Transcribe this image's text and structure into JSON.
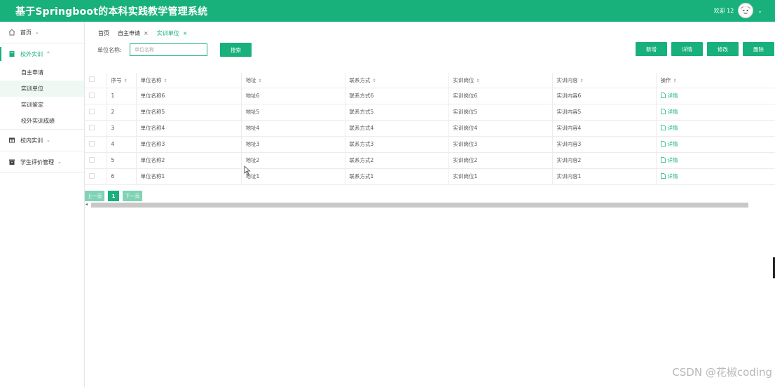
{
  "app": {
    "title": "基于Springboot的本科实践教学管理系统",
    "welcome": "欢迎 12"
  },
  "colors": {
    "accent": "#18b07b",
    "accent_light": "#7fd3b4"
  },
  "sidebar": {
    "home": "首页",
    "group_outside": "校外实训",
    "sub_items": [
      "自主申请",
      "实训单位",
      "实训鉴定",
      "校外实训成绩"
    ],
    "group_inside": "校内实训",
    "group_eval": "学生评价管理"
  },
  "tabs": [
    "首页",
    "自主申请",
    "实训单位"
  ],
  "search": {
    "label": "单位名称:",
    "placeholder": "单位名称",
    "button": "搜索"
  },
  "actions": {
    "add": "新增",
    "detail": "详情",
    "edit": "修改",
    "delete": "删除"
  },
  "table": {
    "headers": [
      "序号",
      "单位名称",
      "地址",
      "联系方式",
      "实训岗位",
      "实训内容",
      "操作"
    ],
    "rows": [
      [
        "1",
        "单位名称6",
        "地址6",
        "联系方式6",
        "实训岗位6",
        "实训内容6",
        "详情"
      ],
      [
        "2",
        "单位名称5",
        "地址5",
        "联系方式5",
        "实训岗位5",
        "实训内容5",
        "详情"
      ],
      [
        "3",
        "单位名称4",
        "地址4",
        "联系方式4",
        "实训岗位4",
        "实训内容4",
        "详情"
      ],
      [
        "4",
        "单位名称3",
        "地址3",
        "联系方式3",
        "实训岗位3",
        "实训内容3",
        "详情"
      ],
      [
        "5",
        "单位名称2",
        "地址2",
        "联系方式2",
        "实训岗位2",
        "实训内容2",
        "详情"
      ],
      [
        "6",
        "单位名称1",
        "地址1",
        "联系方式1",
        "实训岗位1",
        "实训内容1",
        "详情"
      ]
    ]
  },
  "pager": {
    "prev": "上一页",
    "current": "1",
    "next": "下一页"
  },
  "watermark": "CSDN @花椒coding"
}
